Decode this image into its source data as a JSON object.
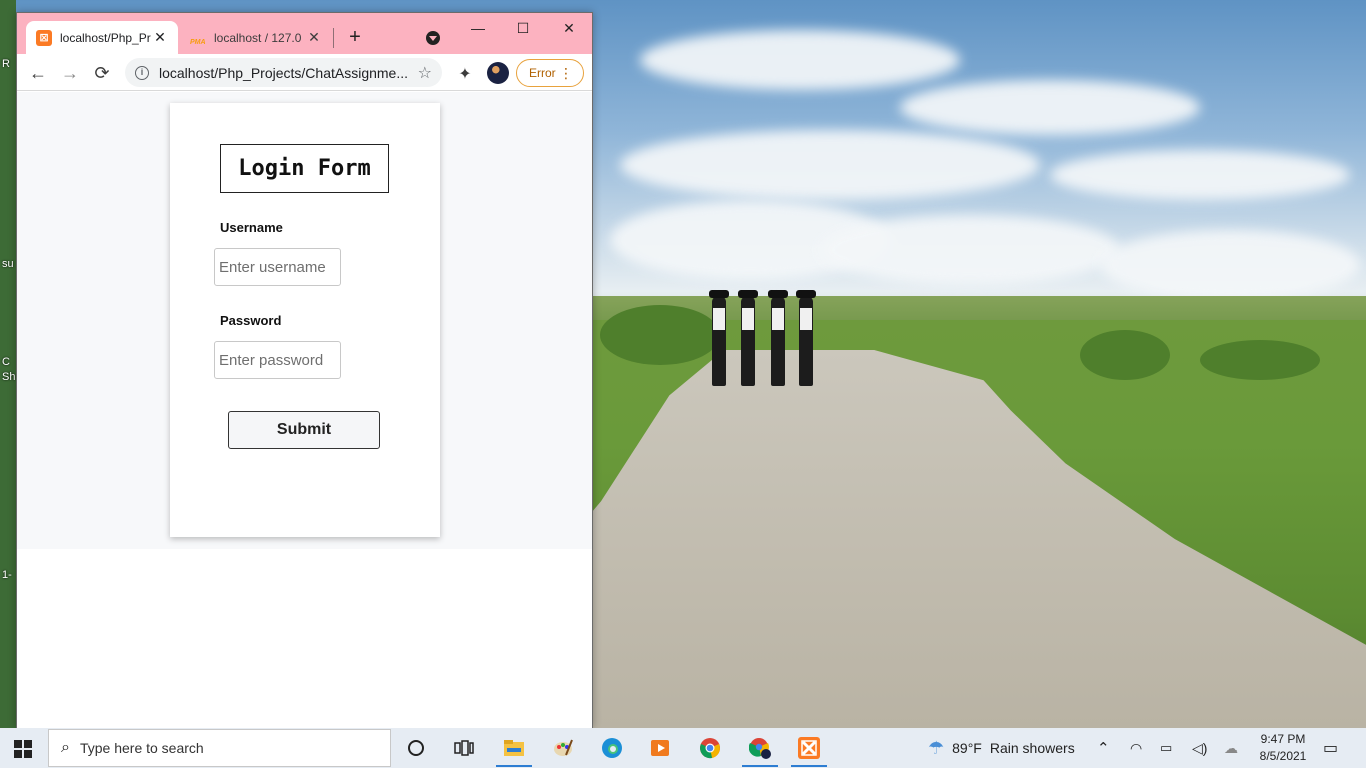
{
  "browser": {
    "tabs": [
      {
        "title": "localhost/Php_Pr",
        "icon": "xampp-icon",
        "active": true
      },
      {
        "title": "localhost / 127.0",
        "icon": "phpmyadmin-icon",
        "active": false
      }
    ],
    "pma_badge": "PMA",
    "xampp_badge": "⊠",
    "new_tab": "+",
    "window_controls": {
      "minimize": "—",
      "maximize": "☐",
      "close": "✕"
    },
    "toolbar": {
      "back": "←",
      "forward": "→",
      "reload": "⟳",
      "info_glyph": "i",
      "url": "localhost/Php_Projects/ChatAssignme...",
      "bookmark": "☆",
      "extensions": "✦",
      "error_label": "Error",
      "menu": "⋮"
    }
  },
  "page": {
    "form_title": "Login Form",
    "username_label": "Username",
    "username_placeholder": "Enter username",
    "password_label": "Password",
    "password_placeholder": "Enter password",
    "submit_label": "Submit"
  },
  "desktop": {
    "snippets": [
      "R",
      "su",
      "C",
      "Sh",
      "1-"
    ]
  },
  "taskbar": {
    "search_placeholder": "Type here to search",
    "weather": {
      "temp": "89°F",
      "condition": "Rain showers"
    },
    "clock": {
      "time": "9:47 PM",
      "date": "8/5/2021"
    },
    "pinned": [
      "cortana-icon",
      "task-view-icon",
      "file-explorer-icon",
      "paint-icon",
      "edge-icon",
      "media-player-icon",
      "chrome-icon",
      "chrome-profile-icon",
      "xampp-icon"
    ]
  },
  "colors": {
    "titlebar": "#fcb2c0",
    "error_accent": "#e8a23d",
    "taskbar": "#e6ecf3"
  }
}
